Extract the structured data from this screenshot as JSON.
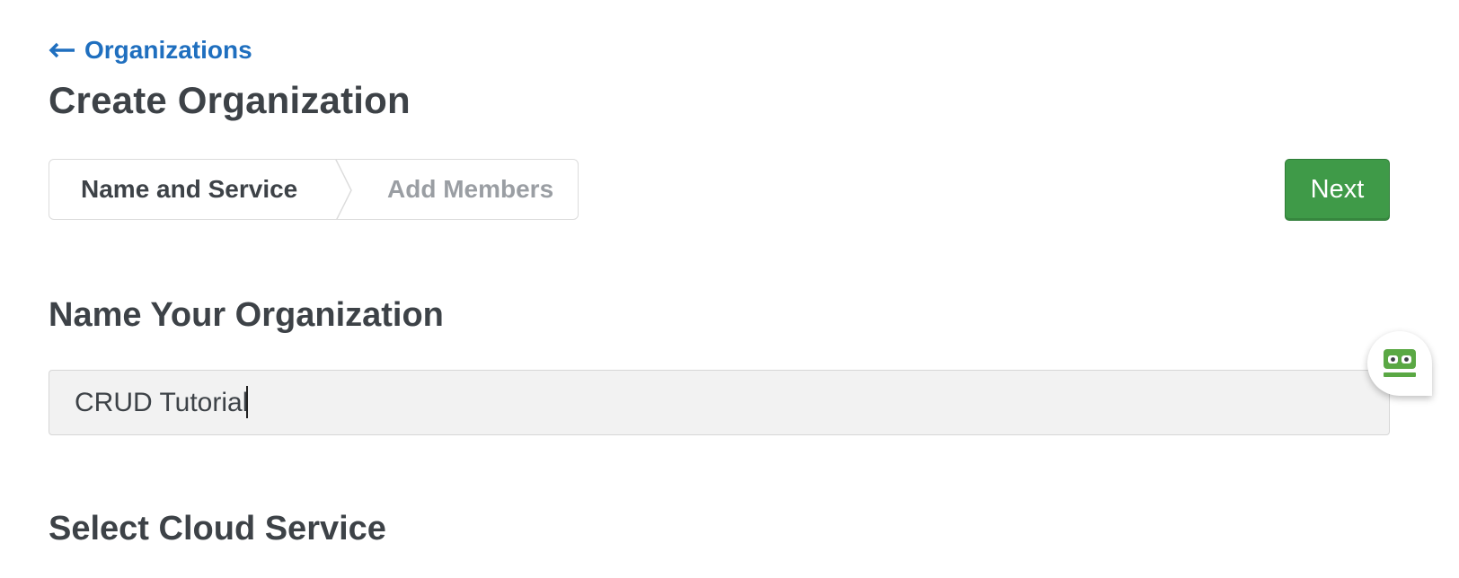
{
  "nav": {
    "back_label": "Organizations",
    "back_icon": "arrow-left-icon"
  },
  "page": {
    "title": "Create Organization"
  },
  "stepper": {
    "steps": [
      {
        "label": "Name and Service",
        "state": "active"
      },
      {
        "label": "Add Members",
        "state": "inactive"
      }
    ]
  },
  "actions": {
    "next_label": "Next"
  },
  "sections": {
    "name_heading": "Name Your Organization",
    "name_value": "CRUD Tutorial",
    "cloud_heading": "Select Cloud Service"
  },
  "extension": {
    "icon": "password-manager-icon"
  },
  "colors": {
    "link": "#1f6fbf",
    "primary_button": "#3f9a48",
    "text": "#3d4247",
    "muted_text": "#9a9ea3",
    "input_bg": "#f2f2f2"
  }
}
